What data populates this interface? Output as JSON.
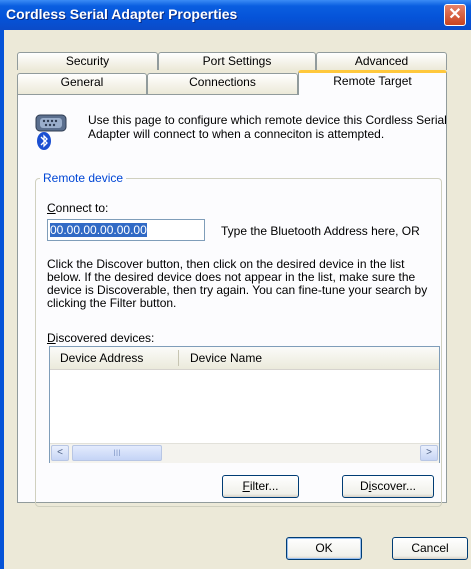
{
  "window": {
    "title": "Cordless Serial Adapter Properties",
    "close_glyph": "✕"
  },
  "tabs_row1": [
    {
      "label": "Security"
    },
    {
      "label": "Port Settings"
    },
    {
      "label": "Advanced"
    }
  ],
  "tabs_row2": [
    {
      "label": "General"
    },
    {
      "label": "Connections"
    },
    {
      "label": "Remote Target",
      "active": true
    }
  ],
  "intro_text": "Use this page to configure which remote device this Cordless Serial Adapter will connect to when a conneciton is attempted.",
  "remote_device": {
    "group_label": "Remote device",
    "connect_to_label_access": "C",
    "connect_to_label_rest": "onnect to:",
    "address_value": "00.00.00.00.00.00",
    "address_hint": "Type the Bluetooth Address here, OR",
    "description": "Click the Discover button, then click on the desired device in the list below. If the desired device does not appear in the list, make sure the device is Discoverable, then try again. You can fine-tune your search by clicking the Filter button.",
    "discovered_label_access": "D",
    "discovered_label_rest": "iscovered devices:",
    "columns": [
      "Device Address",
      "Device Name"
    ],
    "rows": [],
    "scroll_left": "<",
    "scroll_right": ">",
    "thumb_grip": "III"
  },
  "buttons": {
    "filter_access": "F",
    "filter_rest": "ilter...",
    "discover_pre": "D",
    "discover_access": "i",
    "discover_rest": "scover...",
    "ok": "OK",
    "cancel": "Cancel"
  },
  "colors": {
    "title_bar": "#0553d8",
    "group_label": "#0046d5",
    "selection": "#316ac5",
    "active_tab_accent": "#ffc83c"
  }
}
